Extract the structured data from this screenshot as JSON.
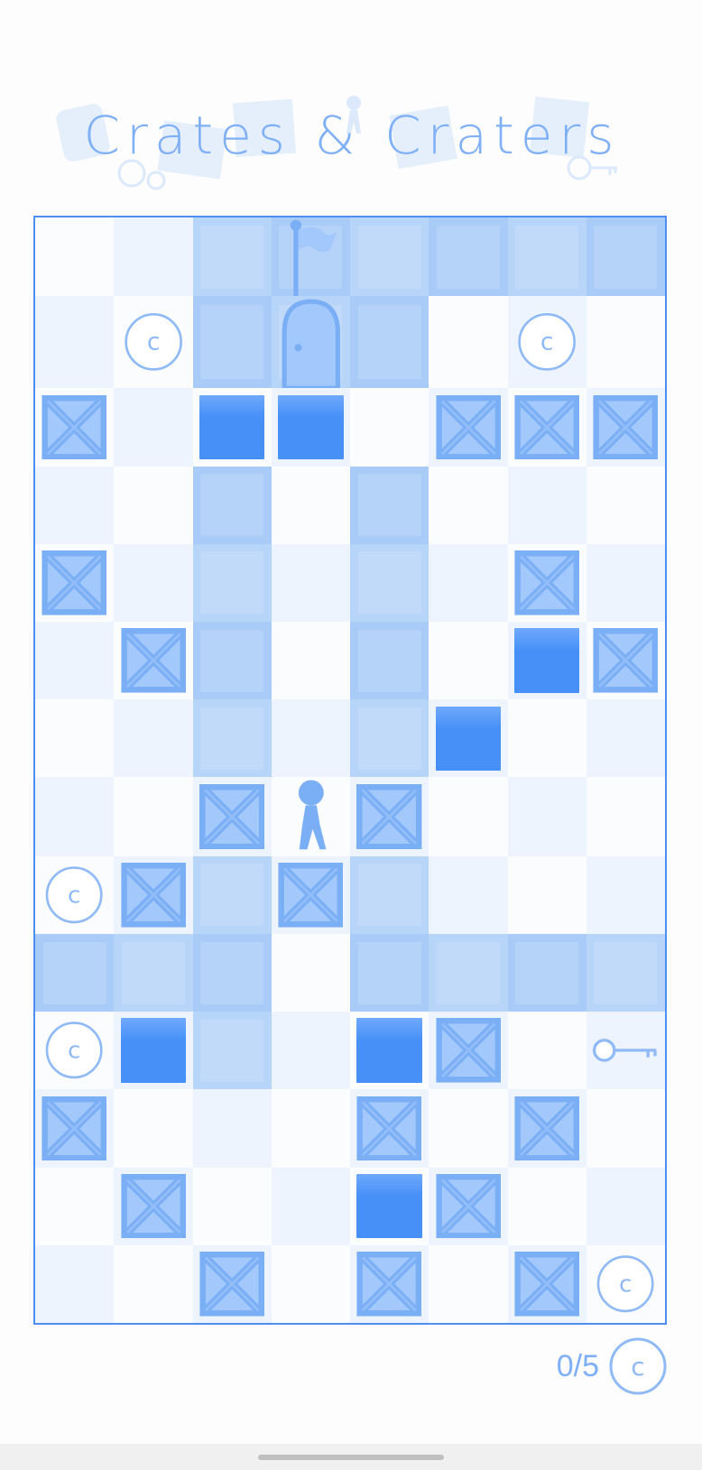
{
  "game": {
    "title": "Crates & Craters"
  },
  "board": {
    "columns": 8,
    "rows": 14,
    "layout": [
      [
        "empty",
        "empty",
        "road",
        "flag",
        "road",
        "road",
        "road",
        "road"
      ],
      [
        "empty",
        "coin",
        "road",
        "door",
        "road",
        "empty",
        "coin",
        "empty"
      ],
      [
        "crate",
        "empty",
        "hole",
        "hole",
        "empty",
        "crate",
        "crate",
        "crate"
      ],
      [
        "empty",
        "empty",
        "road",
        "empty",
        "road",
        "empty",
        "empty",
        "empty"
      ],
      [
        "crate",
        "empty",
        "road",
        "empty",
        "road",
        "empty",
        "crate",
        "empty"
      ],
      [
        "empty",
        "crate",
        "road",
        "empty",
        "road",
        "empty",
        "hole",
        "crate"
      ],
      [
        "empty",
        "empty",
        "road",
        "empty",
        "road",
        "hole",
        "empty",
        "empty"
      ],
      [
        "empty",
        "empty",
        "crate",
        "player",
        "crate",
        "empty",
        "empty",
        "empty"
      ],
      [
        "coin",
        "crate",
        "road",
        "crate",
        "road",
        "empty",
        "empty",
        "empty"
      ],
      [
        "road",
        "road",
        "road",
        "empty",
        "road",
        "road",
        "road",
        "road"
      ],
      [
        "coin",
        "hole",
        "road",
        "empty",
        "hole",
        "crate",
        "empty",
        "key"
      ],
      [
        "crate",
        "empty",
        "empty",
        "empty",
        "crate",
        "empty",
        "crate",
        "empty"
      ],
      [
        "empty",
        "crate",
        "empty",
        "empty",
        "hole",
        "crate",
        "empty",
        "empty"
      ],
      [
        "empty",
        "empty",
        "crate",
        "empty",
        "crate",
        "empty",
        "crate",
        "coin"
      ]
    ]
  },
  "status": {
    "coins_collected": "0/5"
  },
  "colors": {
    "accent": "#7fb0f6",
    "border": "#4c8ff0",
    "road": "#a9cbf7",
    "hole": "#4690f8",
    "crate": "#7aaef5"
  },
  "icons": {
    "crate": "crate-icon",
    "coin": "coin-icon",
    "hole": "crater",
    "key": "key-icon",
    "door": "door-icon",
    "flag": "flag-icon",
    "player": "player-icon"
  }
}
